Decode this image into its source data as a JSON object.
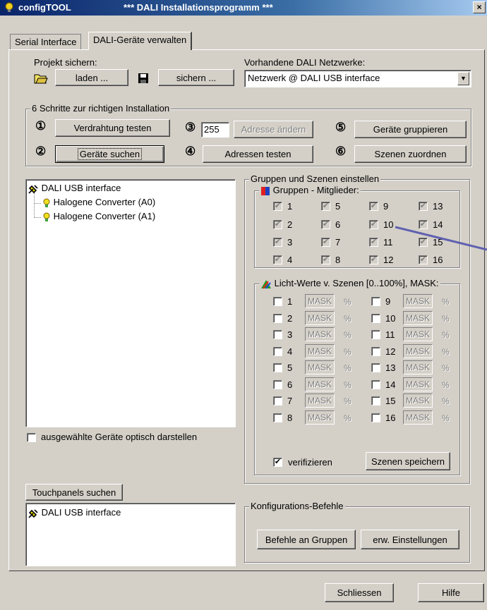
{
  "window": {
    "app_name": "configTOOL",
    "title": "*** DALI Installationsprogramm ***",
    "close_label": "×"
  },
  "tabs": [
    {
      "label": "Serial Interface"
    },
    {
      "label": "DALI-Geräte verwalten"
    }
  ],
  "project": {
    "label": "Projekt sichern:",
    "load_label": "laden ...",
    "save_label": "sichern ..."
  },
  "networks": {
    "label": "Vorhandene DALI Netzwerke:",
    "selected": "Netzwerk @ DALI USB interface"
  },
  "steps": {
    "legend": "6 Schritte zur richtigen Installation",
    "n1": "①",
    "n2": "②",
    "n3": "③",
    "n4": "④",
    "n5": "⑤",
    "n6": "⑥",
    "b1": "Verdrahtung testen",
    "b2": "Geräte suchen",
    "address_value": "255",
    "b3": "Adresse ändern",
    "b4": "Adressen testen",
    "b5": "Geräte gruppieren",
    "b6": "Szenen zuordnen"
  },
  "device_tree": {
    "root": "DALI USB interface",
    "children": [
      "Halogene Converter (A0)",
      "Halogene Converter (A1)"
    ]
  },
  "visual_check_label": "ausgewählte Geräte optisch darstellen",
  "groups_scenes": {
    "legend": "Gruppen und Szenen einstellen",
    "groups_legend": "Gruppen - Mitglieder:",
    "groups": [
      "1",
      "2",
      "3",
      "4",
      "5",
      "6",
      "7",
      "8",
      "9",
      "10",
      "11",
      "12",
      "13",
      "14",
      "15",
      "16"
    ],
    "scenes_legend": "Licht-Werte v. Szenen [0..100%], MASK:",
    "scenes": [
      "1",
      "2",
      "3",
      "4",
      "5",
      "6",
      "7",
      "8",
      "9",
      "10",
      "11",
      "12",
      "13",
      "14",
      "15",
      "16"
    ],
    "mask_text": "MASK",
    "percent": "%",
    "verify_label": "verifizieren",
    "save_scenes_label": "Szenen speichern"
  },
  "touchpanels": {
    "search_label": "Touchpanels suchen",
    "items": [
      "DALI USB interface"
    ]
  },
  "config": {
    "legend": "Konfigurations-Befehle",
    "groups_cmd": "Befehle an Gruppen",
    "advanced": "erw. Einstellungen"
  },
  "footer": {
    "close_label": "Schliessen",
    "help_label": "Hilfe"
  },
  "colors": {
    "title_start": "#0a246a",
    "title_end": "#a6caf0",
    "face": "#d4d0c8",
    "annotation_arrow": "#6060b0"
  }
}
